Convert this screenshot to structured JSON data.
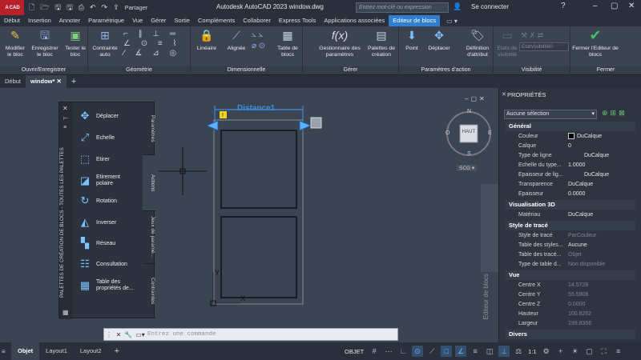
{
  "titlebar": {
    "app_icon": "A",
    "app_icon_sub": "CAD",
    "share_label": "Partager",
    "title": "Autodesk AutoCAD 2023   window.dwg",
    "search_placeholder": "Entrez mot-clé ou expression",
    "signin": "Se connecter"
  },
  "menubar": {
    "tabs": [
      "Début",
      "Insertion",
      "Annoter",
      "Paramétrique",
      "Vue",
      "Gérer",
      "Sortie",
      "Compléments",
      "Collaborer",
      "Express Tools",
      "Applications associées",
      "Editeur de blocs"
    ],
    "active_index": 11
  },
  "ribbon": {
    "groups": [
      {
        "title": "Ouvrir/Enregistrer",
        "buttons": [
          "Modifier le bloc",
          "Enregistrer le bloc",
          "Tester le bloc"
        ]
      },
      {
        "title": "Géométrie",
        "buttons": [
          "Contrainte auto"
        ]
      },
      {
        "title": "Dimensionnelle",
        "buttons": [
          "Linéaire",
          "Alignée",
          "Table de blocs"
        ]
      },
      {
        "title": "Gérer",
        "buttons": [
          "Gestionnaire des paramètres",
          "Palettes de création"
        ]
      },
      {
        "title": "Paramètres d'action",
        "buttons": [
          "Point",
          "Déplacer",
          "Définition d'attribut"
        ]
      },
      {
        "title": "Visibilité",
        "buttons": [
          "Etats de visibilité"
        ],
        "dropdown": "EtatVisibilité0"
      },
      {
        "title": "Fermer",
        "buttons": [
          "Fermer l'Editeur de blocs"
        ]
      }
    ]
  },
  "filetabs": [
    "Début",
    "window*"
  ],
  "palette": {
    "title": "PALETTES DE CRÉATION DE BLOCS - TOUTES LES PALETTES",
    "items": [
      "Déplacer",
      "Echelle",
      "Etirer",
      "Etirement polaire",
      "Rotation",
      "Inverser",
      "Réseau",
      "Consultation",
      "Table des propriétés de..."
    ],
    "tabs": [
      "Paramètres",
      "Actions",
      "Jeux de paramè...",
      "Contraintes"
    ]
  },
  "drawing": {
    "dimension_label": "Distance1",
    "y_label": "Y",
    "x_label": "X",
    "viewcube_face": "HAUT",
    "compass": {
      "n": "N",
      "s": "S",
      "e": "E",
      "o": "O"
    },
    "scu": "SCG",
    "watermark": "Editeur de blocs"
  },
  "properties": {
    "title": "PROPRIÉTÉS",
    "selection": "Aucune sélection",
    "sections": [
      {
        "name": "Général",
        "rows": [
          [
            "Couleur",
            "DuCalque"
          ],
          [
            "Calque",
            "0"
          ],
          [
            "Type de ligne",
            "DuCalque"
          ],
          [
            "Echelle du type...",
            "1.0000"
          ],
          [
            "Epaisseur de lig...",
            "DuCalque"
          ],
          [
            "Transparence",
            "DuCalque"
          ],
          [
            "Epaisseur",
            "0.0000"
          ]
        ]
      },
      {
        "name": "Visualisation 3D",
        "rows": [
          [
            "Matériau",
            "DuCalque"
          ]
        ]
      },
      {
        "name": "Style de tracé",
        "rows": [
          [
            "Style de tracé",
            "ParCouleur"
          ],
          [
            "Table des styles...",
            "Aucune"
          ],
          [
            "Table des tracé...",
            "Objet"
          ],
          [
            "Type de table d...",
            "Non disponible"
          ]
        ]
      },
      {
        "name": "Vue",
        "rows": [
          [
            "Centre X",
            "14.5728"
          ],
          [
            "Centre Y",
            "55.5908"
          ],
          [
            "Centre Z",
            "0.0000"
          ],
          [
            "Hauteur",
            "100.8252"
          ],
          [
            "Largeur",
            "199.8356"
          ]
        ]
      },
      {
        "name": "Divers",
        "rows": []
      }
    ]
  },
  "command": {
    "placeholder": "Entrez une commande"
  },
  "status": {
    "layouts": [
      "Objet",
      "Layout1",
      "Layout2"
    ],
    "model": "OBJET",
    "scale": "1:1"
  }
}
